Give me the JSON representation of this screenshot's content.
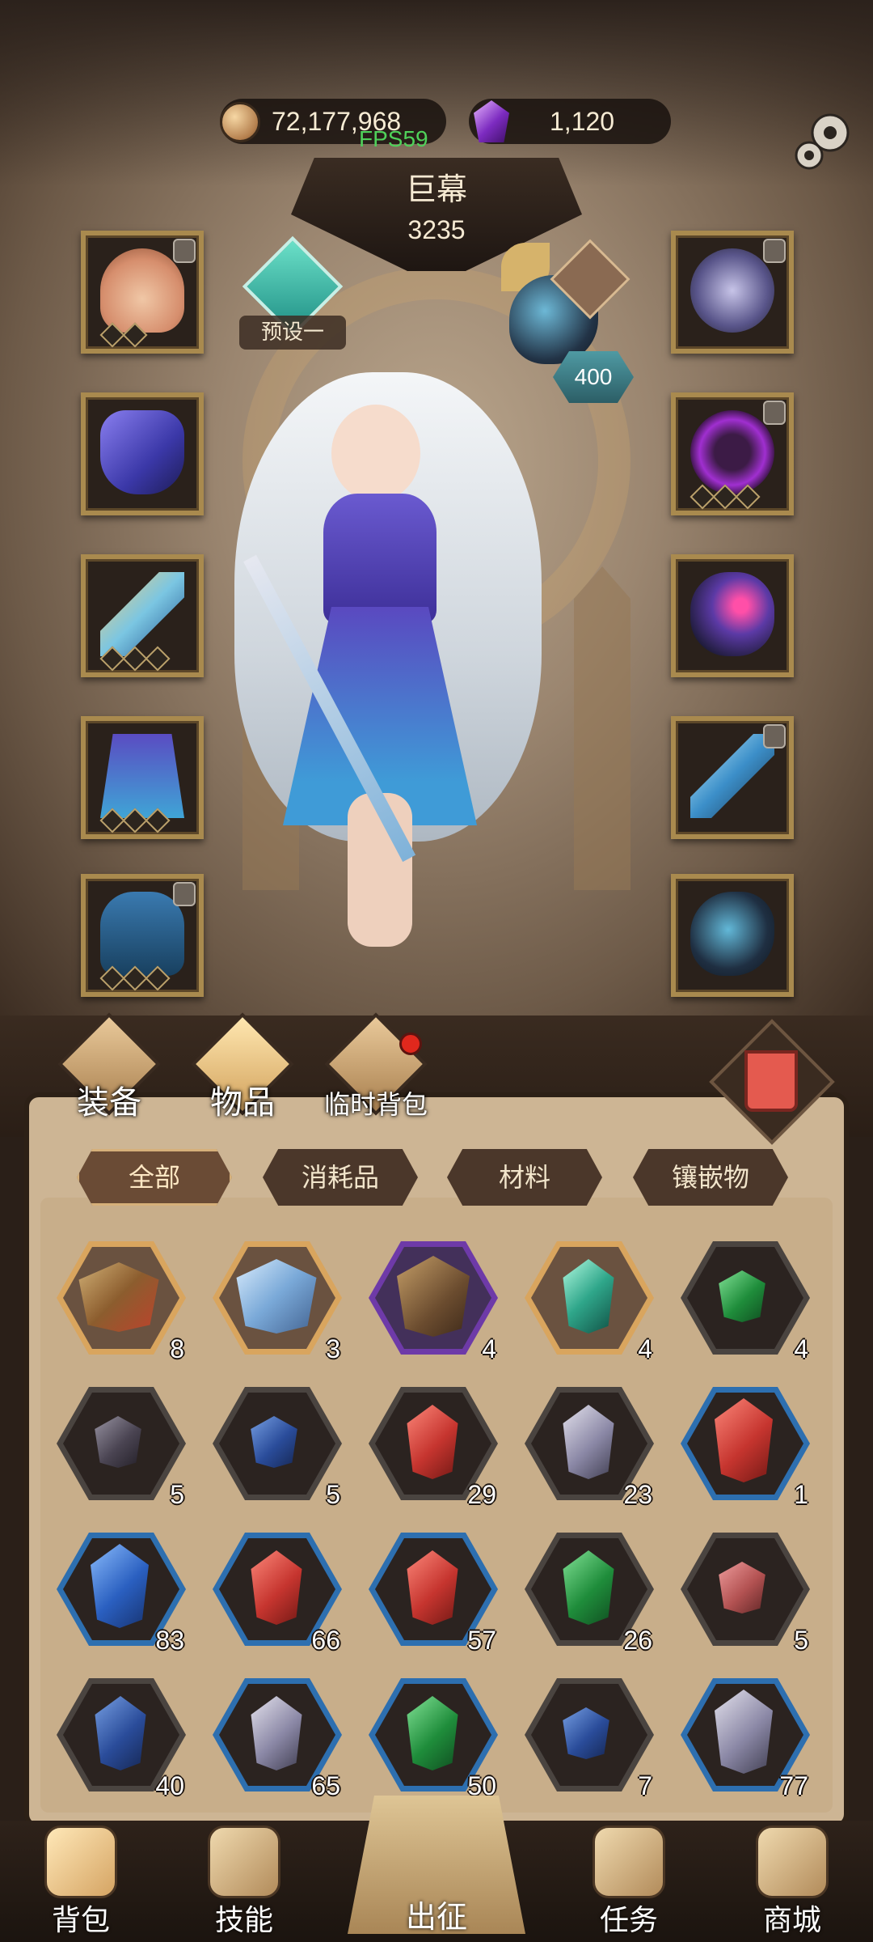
{
  "currency": {
    "gold": "72,177,968",
    "gems": "1,120",
    "fps": "FPS59"
  },
  "header": {
    "title": "巨幕",
    "power": "3235",
    "preset_label": "预设一"
  },
  "mount": {
    "level": "400"
  },
  "equipment": {
    "left": [
      {
        "name": "shell-headpiece",
        "locked": true
      },
      {
        "name": "purple-top",
        "locked": false
      },
      {
        "name": "crystal-staff",
        "locked": false
      },
      {
        "name": "purple-skirt",
        "locked": false
      },
      {
        "name": "shell-boots",
        "locked": true
      }
    ],
    "right": [
      {
        "name": "moon-necklace",
        "locked": true
      },
      {
        "name": "void-ring",
        "locked": true
      },
      {
        "name": "gem-bracelet",
        "locked": false
      },
      {
        "name": "ice-spear",
        "locked": true
      },
      {
        "name": "horned-mount",
        "locked": false
      }
    ]
  },
  "bag_tabs": {
    "equipment": "装备",
    "items": "物品",
    "temp_bag": "临时背包"
  },
  "filters": {
    "all": "全部",
    "consumables": "消耗品",
    "materials": "材料",
    "inlays": "镶嵌物"
  },
  "inventory": [
    {
      "icon": "treasure-chest",
      "qty": "8"
    },
    {
      "icon": "mystery-crystal",
      "qty": "3"
    },
    {
      "icon": "gear-machine",
      "qty": "4"
    },
    {
      "icon": "jade-shard",
      "qty": "4"
    },
    {
      "icon": "green-ore",
      "qty": "4"
    },
    {
      "icon": "dark-ore",
      "qty": "5"
    },
    {
      "icon": "blue-ore",
      "qty": "5"
    },
    {
      "icon": "red-gem",
      "qty": "29"
    },
    {
      "icon": "grey-gem",
      "qty": "23"
    },
    {
      "icon": "red-crystal",
      "qty": "1"
    },
    {
      "icon": "blue-crystal",
      "qty": "83"
    },
    {
      "icon": "red-gem",
      "qty": "66"
    },
    {
      "icon": "red-gem",
      "qty": "57"
    },
    {
      "icon": "green-gem",
      "qty": "26"
    },
    {
      "icon": "rose-ore",
      "qty": "5"
    },
    {
      "icon": "blue-gem",
      "qty": "40"
    },
    {
      "icon": "grey-gem",
      "qty": "65"
    },
    {
      "icon": "green-gem",
      "qty": "50"
    },
    {
      "icon": "blue-ore",
      "qty": "7"
    },
    {
      "icon": "grey-crystal",
      "qty": "77"
    }
  ],
  "nav": {
    "bag": "背包",
    "skills": "技能",
    "expedition": "出征",
    "tasks": "任务",
    "shop": "商城"
  }
}
